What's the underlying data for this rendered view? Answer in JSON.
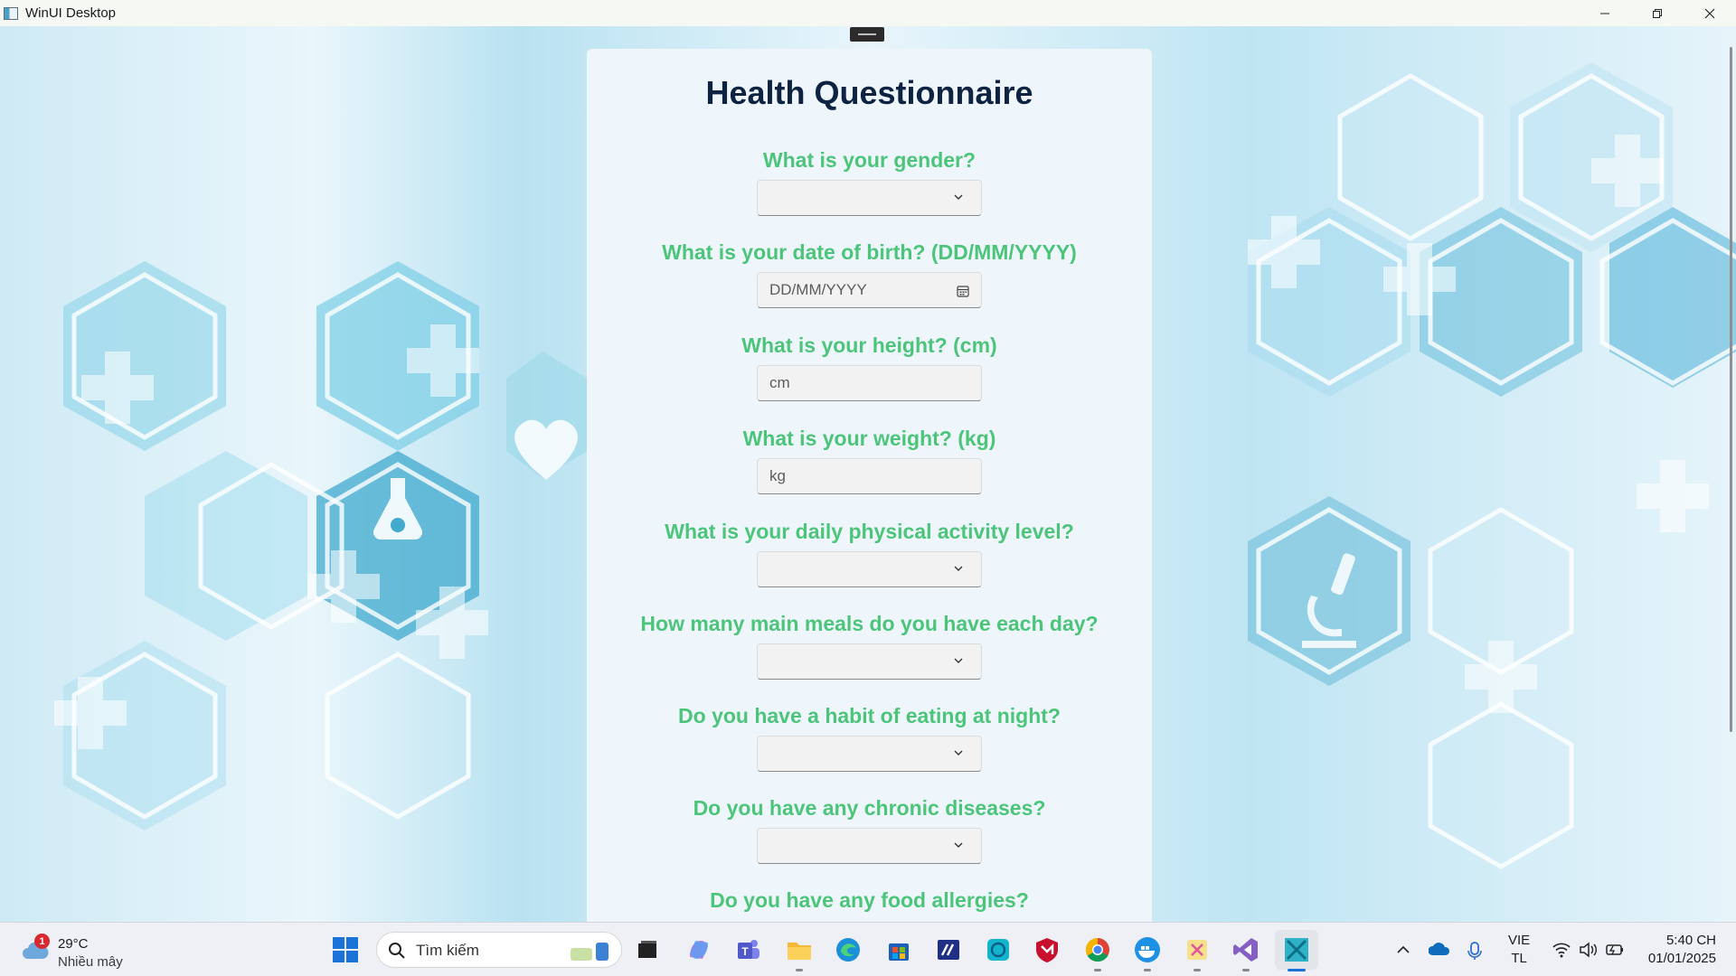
{
  "window": {
    "title": "WinUI Desktop",
    "controls": [
      "minimize",
      "restore",
      "close"
    ]
  },
  "form": {
    "title": "Health Questionnaire",
    "questions": [
      {
        "label": "What is your gender?",
        "type": "dropdown",
        "value": ""
      },
      {
        "label": "What is your date of birth? (DD/MM/YYYY)",
        "type": "date",
        "placeholder": "DD/MM/YYYY"
      },
      {
        "label": "What is your height? (cm)",
        "type": "text",
        "placeholder": "cm"
      },
      {
        "label": "What is your weight? (kg)",
        "type": "text",
        "placeholder": "kg"
      },
      {
        "label": "What is your daily physical activity level?",
        "type": "dropdown",
        "value": ""
      },
      {
        "label": "How many main meals do you have each day?",
        "type": "dropdown",
        "value": ""
      },
      {
        "label": "Do you have a habit of eating at night?",
        "type": "dropdown",
        "value": ""
      },
      {
        "label": "Do you have any chronic diseases?",
        "type": "dropdown",
        "value": ""
      },
      {
        "label": "Do you have any food allergies?",
        "type": "dropdown",
        "value": ""
      }
    ],
    "colors": {
      "title": "#0e2341",
      "question": "#4cc57a",
      "panel": "#eef6fc"
    }
  },
  "taskbar": {
    "weather": {
      "badge": "1",
      "temp": "29°C",
      "condition": "Nhiều mây"
    },
    "search_placeholder": "Tìm kiếm",
    "apps": [
      "windows-start",
      "task-view",
      "copilot",
      "teams",
      "file-explorer",
      "edge",
      "microsoft-store",
      "visual-studio-code-like",
      "cortana-like",
      "mcafee",
      "chrome",
      "docker",
      "snipping-tool",
      "visual-studio",
      "winui-app"
    ],
    "language": {
      "line1": "VIE",
      "line2": "TL"
    },
    "clock": {
      "time": "5:40 CH",
      "date": "01/01/2025"
    }
  }
}
